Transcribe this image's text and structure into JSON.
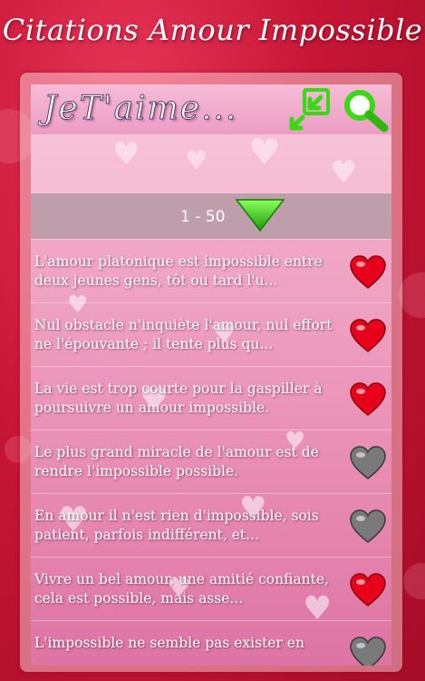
{
  "app": {
    "title": "Citations Amour Impossible"
  },
  "header": {
    "logo_text": "JeT'aime..."
  },
  "pager": {
    "label": "1 - 50"
  },
  "colors": {
    "fav_on": "#e8001a",
    "fav_off": "#7a7a7a",
    "accent_green": "#3bd816"
  },
  "quotes": [
    {
      "text": "L'amour platonique est impossible entre deux jeunes gens, tôt ou tard l'u...",
      "favorite": true
    },
    {
      "text": "Nul obstacle n'inquiète l'amour, nul effort ne l'épouvante ; il tente plus qu...",
      "favorite": true
    },
    {
      "text": "La vie est trop courte pour la gaspiller à poursuivre un amour impossible.",
      "favorite": true
    },
    {
      "text": "Le plus grand miracle de l'amour est de rendre l'impossible possible.",
      "favorite": false
    },
    {
      "text": "En amour il n'est rien d'impossible, sois patient, parfois indifférent, et...",
      "favorite": false
    },
    {
      "text": "Vivre un bel amour, une amitié confiante, cela est possible, mais asse...",
      "favorite": true
    },
    {
      "text": "L'impossible ne semble pas exister en",
      "favorite": false
    }
  ]
}
